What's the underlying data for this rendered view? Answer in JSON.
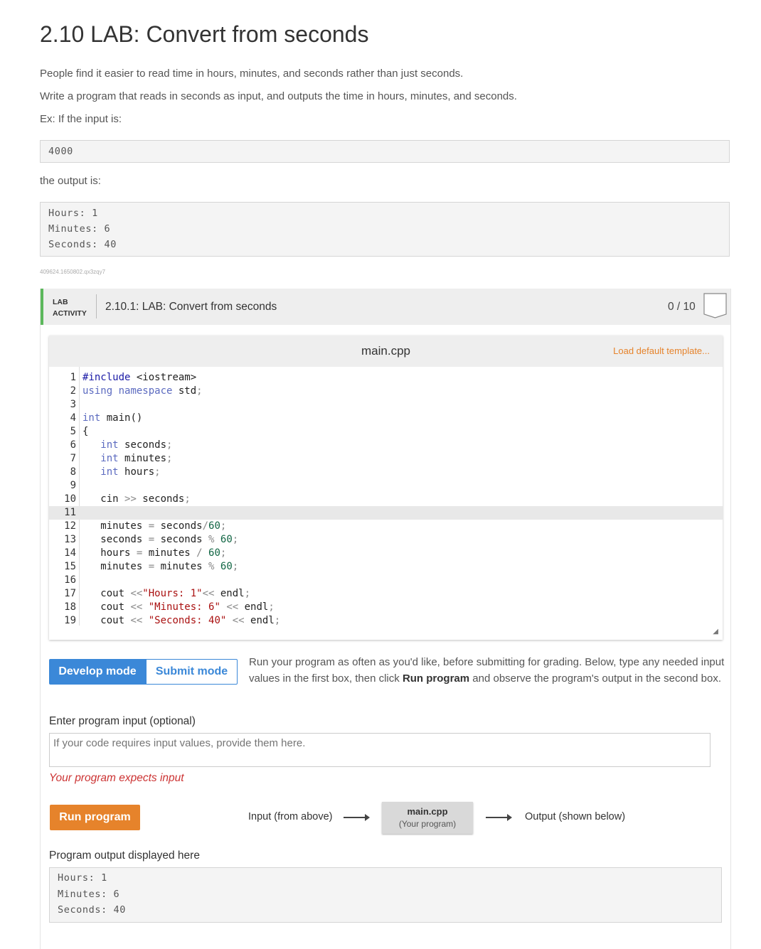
{
  "title": "2.10 LAB: Convert from seconds",
  "intro": [
    "People find it easier to read time in hours, minutes, and seconds rather than just seconds.",
    "Write a program that reads in seconds as input, and outputs the time in hours, minutes, and seconds.",
    "Ex: If the input is:"
  ],
  "example_input": "4000",
  "output_intro": "the output is:",
  "example_output": [
    "Hours: 1",
    "Minutes: 6",
    "Seconds: 40"
  ],
  "content_id": "409624.1650802.qx3zqy7",
  "lab": {
    "label_line1": "LAB",
    "label_line2": "ACTIVITY",
    "title": "2.10.1: LAB: Convert from seconds",
    "score": "0 / 10",
    "accent_color": "#5cb85c"
  },
  "editor": {
    "file_name": "main.cpp",
    "load_default": "Load default template...",
    "active_line": 11,
    "line_numbers": [
      "1",
      "2",
      "3",
      "4",
      "5",
      "6",
      "7",
      "8",
      "9",
      "10",
      "11",
      "12",
      "13",
      "14",
      "15",
      "16",
      "17",
      "18",
      "19"
    ],
    "lines": [
      "#include <iostream>",
      "using namespace std;",
      "",
      "int main()",
      "{",
      "   int seconds;",
      "   int minutes;",
      "   int hours;",
      "",
      "   cin >> seconds;",
      "",
      "   minutes = seconds/60;",
      "   seconds = seconds % 60;",
      "   hours = minutes / 60;",
      "   minutes = minutes % 60;",
      "",
      "   cout <<\"Hours: 1\"<< endl;",
      "   cout << \"Minutes: 6\" << endl;",
      "   cout << \"Seconds: 40\" << endl;"
    ]
  },
  "modes": {
    "develop": "Develop mode",
    "submit": "Submit mode",
    "description_pre": "Run your program as often as you'd like, before submitting for grading. Below, type any needed input values in the first box, then click ",
    "description_bold": "Run program",
    "description_post": " and observe the program's output in the second box."
  },
  "input": {
    "label": "Enter program input (optional)",
    "placeholder": "If your code requires input values, provide them here.",
    "warning": "Your program expects input"
  },
  "run": {
    "button": "Run program",
    "flow_input": "Input (from above)",
    "flow_file": "main.cpp",
    "flow_file_sub": "(Your program)",
    "flow_output": "Output (shown below)"
  },
  "output": {
    "label": "Program output displayed here",
    "lines": [
      "Hours: 1",
      "Minutes: 6",
      "Seconds: 40"
    ]
  },
  "colors": {
    "primary_blue": "#3b88d8",
    "run_orange": "#e6832b",
    "warning_red": "#cc3333"
  }
}
